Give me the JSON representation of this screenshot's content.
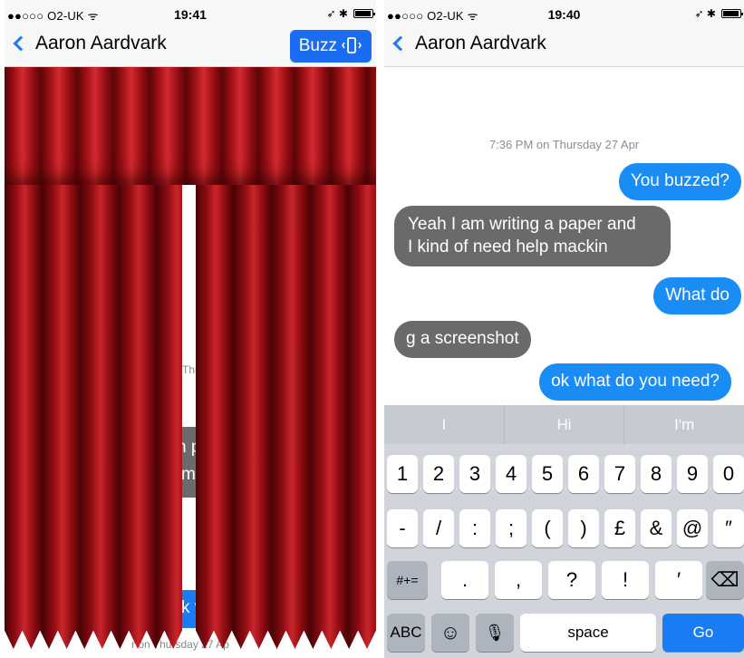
{
  "left": {
    "status": {
      "carrier": "●●○○○ O2-UK ᯤ",
      "time": "19:41",
      "right": "➶ ✱"
    },
    "nav": {
      "back_label": "Aaron Aardvark",
      "buzz_label": "Buzz"
    },
    "peek": {
      "t1": "Thu",
      "t2": "n p",
      "t3": "m",
      "t4": "k v",
      "t5": "r on Thursday 27 Ap"
    }
  },
  "right": {
    "status": {
      "carrier": "●●○○○ O2-UK ᯤ",
      "time": "19:40",
      "right": "➶ ✱"
    },
    "nav": {
      "back_label": "Aaron Aardvark"
    },
    "timestamp": "7:36 PM on Thursday 27 Apr",
    "messages": [
      {
        "dir": "out",
        "text": "You buzzed?"
      },
      {
        "dir": "in",
        "text": "Yeah I am writing a paper and\nI kind of need help mackin"
      },
      {
        "dir": "out",
        "text": "What do"
      },
      {
        "dir": "in",
        "text": "g a screenshot"
      },
      {
        "dir": "out",
        "text": "ok what do you need?"
      }
    ],
    "keyboard": {
      "predictions": [
        "I",
        "Hi",
        "I'm"
      ],
      "row1": [
        "1",
        "2",
        "3",
        "4",
        "5",
        "6",
        "7",
        "8",
        "9",
        "0"
      ],
      "row2": [
        "-",
        "/",
        ":",
        ";",
        "(",
        ")",
        "£",
        "&",
        "@",
        "″"
      ],
      "row3": [
        "#+=",
        ".",
        ",",
        "?",
        "!",
        "′",
        "⌫"
      ],
      "row4": {
        "abc": "ABC",
        "emoji": "☺",
        "mic": "🎙",
        "space": "space",
        "go": "Go"
      }
    }
  }
}
